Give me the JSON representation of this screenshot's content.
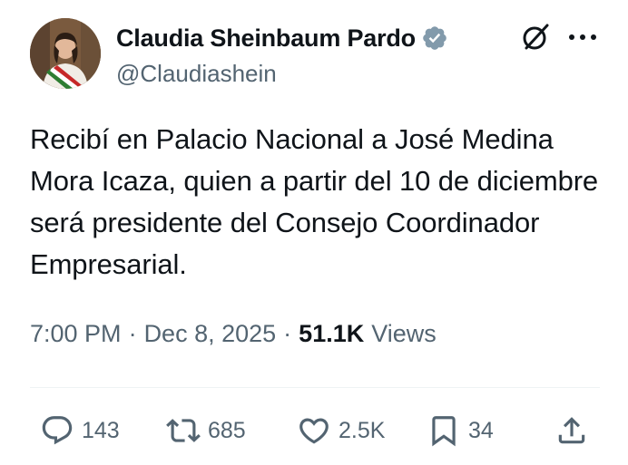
{
  "author": {
    "display_name": "Claudia Sheinbaum Pardo",
    "handle": "@Claudiashein",
    "verified": true,
    "verified_color": "#829aab"
  },
  "header_icons": {
    "grok": "grok-icon",
    "more": "more-icon"
  },
  "tweet": {
    "text": "Recibí en Palacio Nacional a José Medina Mora Icaza, quien a partir del 10 de diciembre será presidente del Consejo Coordinador Empresarial."
  },
  "meta": {
    "time": "7:00 PM",
    "separator": "·",
    "date": "Dec 8, 2025",
    "views_count": "51.1K",
    "views_label": "Views"
  },
  "actions": {
    "reply": {
      "icon": "reply-icon",
      "count": "143"
    },
    "retweet": {
      "icon": "retweet-icon",
      "count": "685"
    },
    "like": {
      "icon": "heart-icon",
      "count": "2.5K"
    },
    "bookmark": {
      "icon": "bookmark-icon",
      "count": "34"
    },
    "share": {
      "icon": "share-icon"
    }
  },
  "colors": {
    "text_primary": "#0f1419",
    "text_secondary": "#536471",
    "divider": "#eff3f4"
  }
}
